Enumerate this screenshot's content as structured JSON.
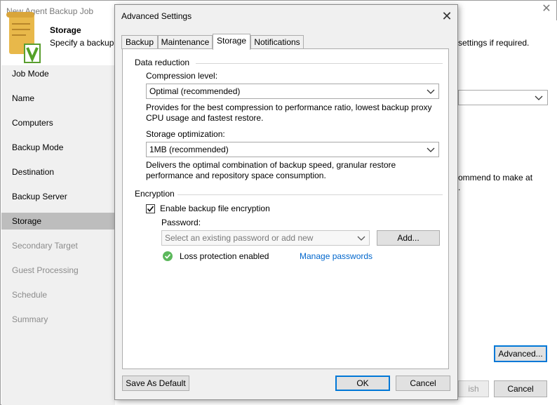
{
  "wizard": {
    "title": "New Agent Backup Job",
    "header_title": "Storage",
    "header_desc": "Specify a backup",
    "header_desc_right": "settings if required.",
    "steps": [
      {
        "label": "Job Mode",
        "state": "done"
      },
      {
        "label": "Name",
        "state": "done"
      },
      {
        "label": "Computers",
        "state": "done"
      },
      {
        "label": "Backup Mode",
        "state": "done"
      },
      {
        "label": "Destination",
        "state": "done"
      },
      {
        "label": "Backup Server",
        "state": "done"
      },
      {
        "label": "Storage",
        "state": "active"
      },
      {
        "label": "Secondary Target",
        "state": "future"
      },
      {
        "label": "Guest Processing",
        "state": "future"
      },
      {
        "label": "Schedule",
        "state": "future"
      },
      {
        "label": "Summary",
        "state": "future"
      }
    ],
    "recommend_text_line1": "ommend to make at",
    "recommend_text_line2": ".",
    "advanced_button": "Advanced...",
    "finish_button": "ish",
    "cancel_button": "Cancel"
  },
  "dialog": {
    "title": "Advanced Settings",
    "tabs": [
      "Backup",
      "Maintenance",
      "Storage",
      "Notifications"
    ],
    "active_tab": "Storage",
    "data_reduction": {
      "section_label": "Data reduction",
      "compression_label": "Compression level:",
      "compression_value": "Optimal (recommended)",
      "compression_desc_line1": "Provides for the best compression to performance ratio, lowest backup proxy",
      "compression_desc_line2": "CPU usage and fastest restore.",
      "optimization_label": "Storage optimization:",
      "optimization_value": "1MB (recommended)",
      "optimization_desc_line1": "Delivers the optimal combination of backup speed, granular restore",
      "optimization_desc_line2": "performance and repository space consumption."
    },
    "encryption": {
      "section_label": "Encryption",
      "enable_label": "Enable backup file encryption",
      "enable_checked": true,
      "password_label": "Password:",
      "password_placeholder": "Select an existing password or add new",
      "add_button": "Add...",
      "loss_protection": "Loss protection enabled",
      "manage_link": "Manage passwords"
    },
    "save_default_button": "Save As Default",
    "ok_button": "OK",
    "cancel_button": "Cancel"
  },
  "colors": {
    "active_step_bg": "#bdbdbd",
    "left_panel_bg": "#f0f0f0",
    "link": "#0066cc",
    "focus_border": "#0078d7",
    "ok_green": "#5cb85c"
  }
}
